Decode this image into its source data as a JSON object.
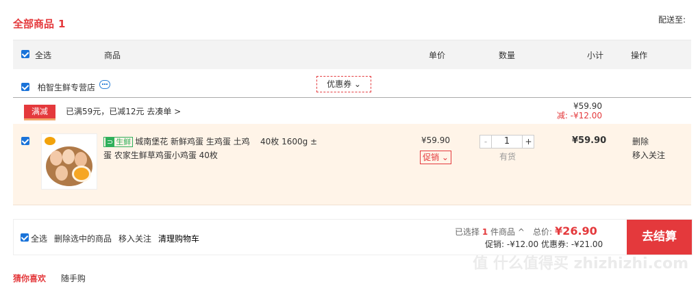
{
  "header": {
    "title": "全部商品",
    "count": "1",
    "deliver_to": "配送至:"
  },
  "table_header": {
    "select_all": "全选",
    "product": "商品",
    "unit_price": "单价",
    "quantity": "数量",
    "subtotal": "小计",
    "operation": "操作"
  },
  "shop": {
    "name": "柏智生鲜专营店",
    "coupon": "优惠券 ⌄"
  },
  "promotion": {
    "tag": "满减",
    "text": "已满59元，已减12元 去凑单 >",
    "price": "¥59.90",
    "reduce": "减: -¥12.00"
  },
  "item": {
    "fresh_label": "生鲜",
    "name": "城南堡花 新鲜鸡蛋 生鸡蛋 土鸡蛋 农家生鲜草鸡蛋小鸡蛋 40枚",
    "spec": "40枚 1600g ±",
    "price": "¥59.90",
    "promo_btn": "促销 ⌄",
    "qty_minus": "-",
    "qty_value": "1",
    "qty_plus": "+",
    "stock": "有货",
    "line_total": "¥59.90",
    "delete": "删除",
    "follow": "移入关注"
  },
  "footer": {
    "select_all": "全选",
    "delete_selected": "删除选中的商品",
    "move_follow": "移入关注",
    "clear_cart": "清理购物车",
    "selected_prefix": "已选择",
    "selected_count": "1",
    "selected_suffix": "件商品 ^",
    "total_label": "总价:",
    "total_value": "¥26.90",
    "discount_text": "促销: -¥12.00 优惠券: -¥21.00",
    "checkout": "去结算"
  },
  "bottom_tabs": {
    "tab1": "猜你喜欢",
    "tab2": "随手购"
  },
  "watermark": "值 什么值得买 zhizhizhi.com",
  "colors": {
    "accent": "#e4393c",
    "fresh": "#2fb05b",
    "checkbox": "#1a73d9"
  }
}
